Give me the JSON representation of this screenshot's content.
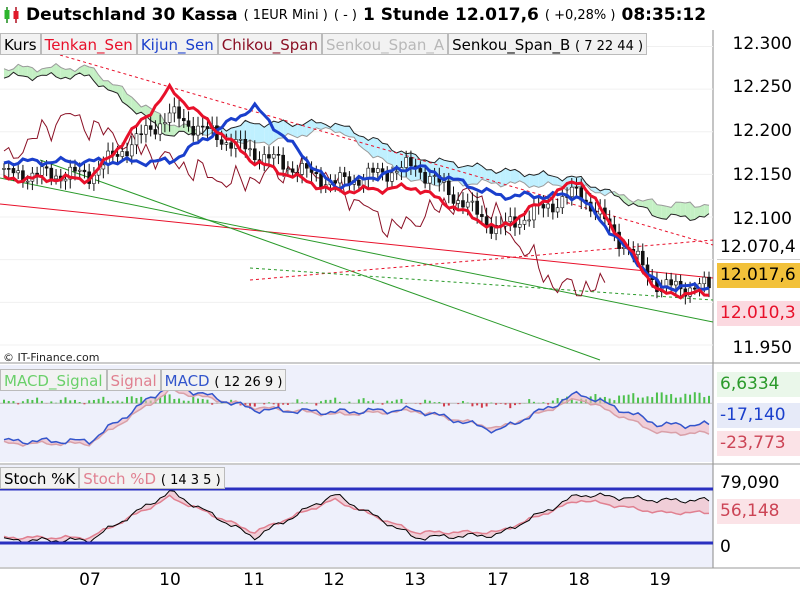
{
  "title": {
    "instrument": "Deutschland 30 Kassa",
    "contract": "( 1EUR Mini )",
    "marker": "( - )",
    "timeframe": "1 Stunde",
    "price": "12.017,6",
    "change": "( +0,28% )",
    "time": "08:35:12"
  },
  "credit": "© IT-Finance.com",
  "colors": {
    "tenkan": "#e8102a",
    "kijun": "#1a3fcc",
    "chikou": "#8a0f24",
    "cloud_bull": "#c4f0c4",
    "cloud_bear": "#bff0ff",
    "macd_signal": "#d9a0a8",
    "macd": "#3355cc",
    "stoch_k": "#000000",
    "stoch_d": "#e08090",
    "price_box": "#f2c13a",
    "pink_box": "#fbd9e0"
  },
  "panels": {
    "price": {
      "legend": [
        {
          "label": "Kurs",
          "color": "#000000"
        },
        {
          "label": "Tenkan_Sen",
          "color": "#e8102a"
        },
        {
          "label": "Kijun_Sen",
          "color": "#1a3fcc"
        },
        {
          "label": "Chikou_Span",
          "color": "#8a0f24"
        },
        {
          "label": "Senkou_Span_A",
          "color": "#b8b8b8"
        },
        {
          "label": "Senkou_Span_B",
          "color": "#000000"
        }
      ],
      "legend_params": "( 7 22 44 )",
      "y_ticks": [
        "12.300",
        "12.250",
        "12.200",
        "12.150",
        "12.100",
        "11.950"
      ],
      "value_boxes": [
        {
          "label": "12.070,4",
          "color": "#000000",
          "bg": "#ffffff"
        },
        {
          "label": "12.017,6",
          "color": "#000000",
          "bg": "#f2c13a"
        },
        {
          "label": "12.010,3",
          "color": "#e8102a",
          "bg": "#fbd9e0"
        }
      ]
    },
    "macd": {
      "legend": [
        {
          "label": "MACD_Signal",
          "color": "#6ad06a"
        },
        {
          "label": "Signal",
          "color": "#e08090"
        },
        {
          "label": "MACD",
          "color": "#3355cc"
        }
      ],
      "legend_params": "( 12 26 9 )",
      "value_boxes": [
        {
          "label": "6,6334",
          "color": "#2a9a2a"
        },
        {
          "label": "-17,140",
          "color": "#1a3fcc"
        },
        {
          "label": "-23,773",
          "color": "#cc4455"
        }
      ]
    },
    "stoch": {
      "legend": [
        {
          "label": "Stoch %K",
          "color": "#000000"
        },
        {
          "label": "Stoch %D",
          "color": "#e08090"
        }
      ],
      "legend_params": "( 14 3 5 )",
      "value_boxes": [
        {
          "label": "79,090",
          "color": "#000000"
        },
        {
          "label": "56,148",
          "color": "#cc4455"
        },
        {
          "label": "0",
          "color": "#000000"
        }
      ]
    }
  },
  "x_ticks": [
    "07",
    "10",
    "11",
    "12",
    "13",
    "17",
    "18",
    "19"
  ],
  "chart_data": [
    {
      "type": "line",
      "subtype": "candlestick-ichimoku",
      "ylim": [
        11930,
        12310
      ],
      "x": [
        "07",
        "10",
        "11",
        "12",
        "13",
        "17",
        "18",
        "19"
      ],
      "series": [
        {
          "name": "Kurs",
          "values": [
            12150,
            12220,
            12175,
            12140,
            12160,
            12085,
            12130,
            12018
          ]
        },
        {
          "name": "Tenkan_Sen",
          "values": [
            12145,
            12250,
            12165,
            12130,
            12135,
            12085,
            12145,
            12010
          ]
        },
        {
          "name": "Kijun_Sen",
          "values": [
            12165,
            12165,
            12230,
            12135,
            12160,
            12125,
            12125,
            12018
          ]
        },
        {
          "name": "Senkou_Span_A",
          "values": [
            12275,
            12210,
            12185,
            12205,
            12140,
            12140,
            12135,
            12115
          ]
        },
        {
          "name": "Senkou_Span_B",
          "values": [
            12265,
            12195,
            12210,
            12210,
            12170,
            12155,
            12145,
            12100
          ]
        }
      ]
    },
    {
      "type": "area",
      "ylim": [
        -45,
        20
      ],
      "x": [
        "07",
        "10",
        "11",
        "12",
        "13",
        "17",
        "18",
        "19"
      ],
      "series": [
        {
          "name": "MACD",
          "values": [
            -30,
            15,
            -5,
            -7,
            -5,
            -22,
            8,
            -17.14
          ]
        },
        {
          "name": "Signal",
          "values": [
            -32,
            10,
            -3,
            -9,
            -6,
            -20,
            4,
            -23.773
          ]
        },
        {
          "name": "MACD_Signal",
          "values": [
            2,
            5,
            -2,
            2,
            1,
            -2,
            4,
            6.6334
          ]
        }
      ]
    },
    {
      "type": "line",
      "ylim": [
        0,
        100
      ],
      "x": [
        "07",
        "10",
        "11",
        "12",
        "13",
        "17",
        "18",
        "19"
      ],
      "series": [
        {
          "name": "Stoch %K",
          "values": [
            5,
            95,
            10,
            90,
            10,
            15,
            90,
            79.09
          ]
        },
        {
          "name": "Stoch %D",
          "values": [
            10,
            85,
            20,
            80,
            20,
            20,
            80,
            56.148
          ]
        }
      ]
    }
  ]
}
